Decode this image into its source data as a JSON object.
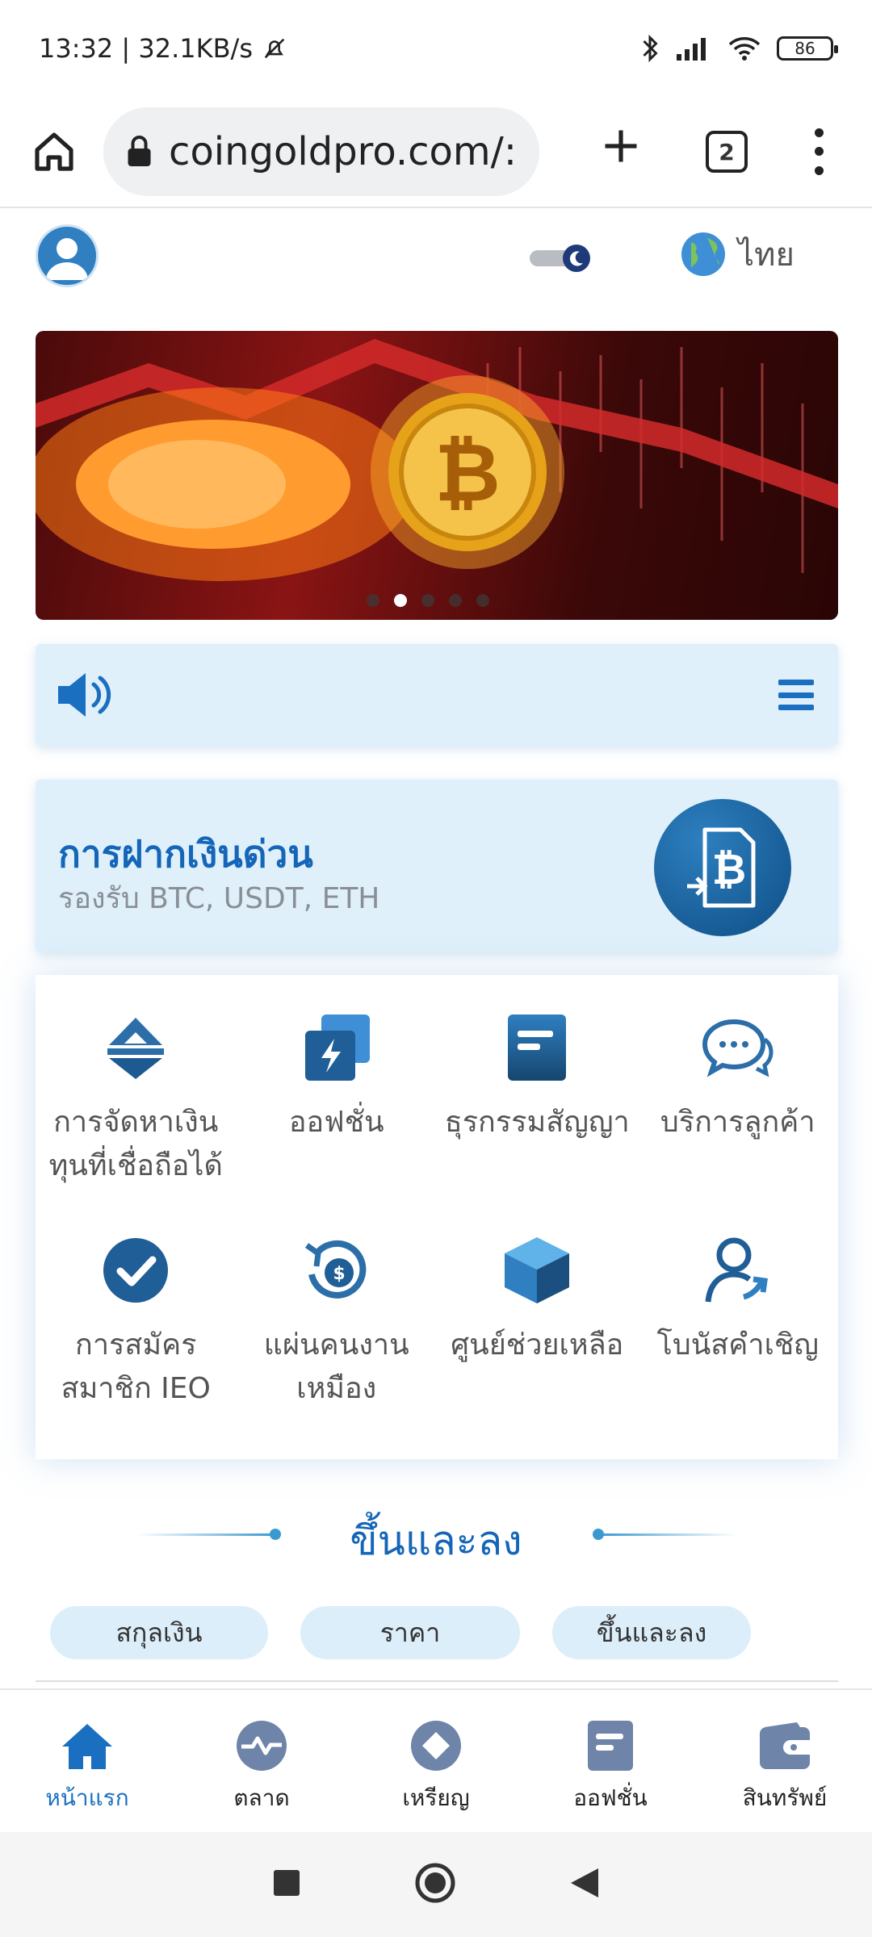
{
  "status": {
    "time_speed": "13:32 | 32.1KB/s",
    "battery": "86"
  },
  "browser": {
    "url": "coingoldpro.com/:",
    "tab_count": "2"
  },
  "header": {
    "language": "ไทย"
  },
  "banner": {
    "slide_count": 5,
    "active_slide": 2
  },
  "deposit": {
    "title": "การฝากเงินด่วน",
    "subtitle": "รองรับ BTC, USDT, ETH"
  },
  "grid": {
    "items": [
      {
        "label": "การจัดหาเงินทุนที่เชื่อถือได้",
        "icon": "funding-icon"
      },
      {
        "label": "ออฟชั่น",
        "icon": "options-icon"
      },
      {
        "label": "ธุรกรรมสัญญา",
        "icon": "contract-icon"
      },
      {
        "label": "บริการลูกค้า",
        "icon": "chat-icon"
      },
      {
        "label": "การสมัครสมาชิก IEO",
        "icon": "check-icon"
      },
      {
        "label": "แผ่นคนงานเหมือง",
        "icon": "mining-icon"
      },
      {
        "label": "ศูนย์ช่วยเหลือ",
        "icon": "cube-icon"
      },
      {
        "label": "โบนัสคำเชิญ",
        "icon": "invite-icon"
      }
    ]
  },
  "market": {
    "title": "ขึ้นและลง",
    "columns": [
      "สกุลเงิน",
      "ราคา",
      "ขึ้นและลง"
    ]
  },
  "nav": {
    "items": [
      {
        "label": "หน้าแรก",
        "icon": "home-icon"
      },
      {
        "label": "ตลาด",
        "icon": "market-icon"
      },
      {
        "label": "เหรียญ",
        "icon": "coin-icon"
      },
      {
        "label": "ออฟชั่น",
        "icon": "options-doc-icon"
      },
      {
        "label": "สินทรัพย์",
        "icon": "wallet-icon"
      }
    ]
  },
  "colors": {
    "accent": "#1a6fc0",
    "panel": "#dff0fb"
  }
}
